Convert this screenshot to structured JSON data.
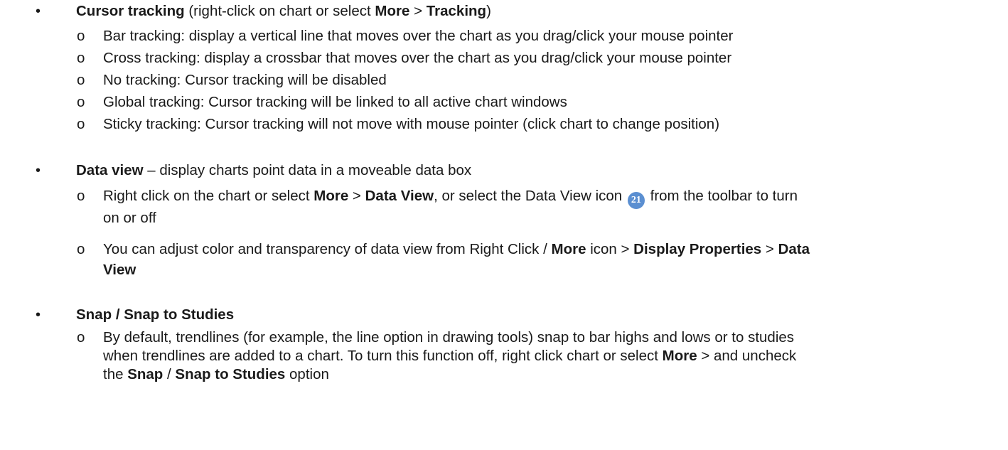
{
  "sections": {
    "cursor": {
      "title": "Cursor tracking",
      "intro_pre": " (right-click on chart or select ",
      "more": "More",
      "gt": " > ",
      "tracking": "Tracking",
      "intro_post": ")",
      "items": [
        "Bar tracking: display a vertical line that moves over the chart as you drag/click your mouse pointer",
        "Cross tracking: display a crossbar that moves over the chart as you drag/click your mouse pointer",
        "No tracking: Cursor tracking will be disabled",
        "Global tracking: Cursor tracking will be linked to all active chart windows",
        "Sticky tracking: Cursor tracking will not move with mouse pointer (click chart to change position)"
      ]
    },
    "dataview": {
      "title": "Data view",
      "desc": " – display charts point data in a moveable data box",
      "item1": {
        "pre": "Right click on the chart or select ",
        "more": "More",
        "gt": " > ",
        "dataview": "Data View",
        "mid": ", or select the Data View icon ",
        "badge": "21",
        "post": " from the toolbar to turn",
        "line2": "on or off"
      },
      "item2": {
        "pre": "You can adjust color and transparency of data view from Right Click / ",
        "more": "More",
        "mid": " icon > ",
        "display": "Display Properties",
        "gt": " > ",
        "data": "Data",
        "line2": "View"
      }
    },
    "snap": {
      "title": "Snap / Snap to Studies",
      "item1": {
        "line1": "By default, trendlines (for example, the line option in drawing tools) snap to bar highs and lows or to studies",
        "line2_pre": "when trendlines are added to a chart. To turn this function off, right click chart or select ",
        "more": "More",
        "line2_post": " > and uncheck",
        "line3_pre": "the ",
        "snap": "Snap",
        "slash": " / ",
        "snap_studies": "Snap to Studies",
        "line3_post": " option"
      }
    }
  },
  "bullets": {
    "level1": "•",
    "level2": "o"
  },
  "colors": {
    "text": "#1a1a1a",
    "badge": "#5b8fd1"
  }
}
